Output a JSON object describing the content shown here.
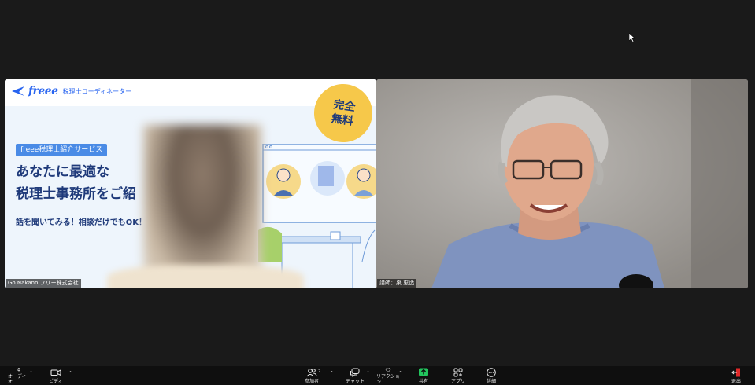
{
  "left_tile": {
    "logo_text": "freee",
    "logo_subtitle": "税理士コーディネーター",
    "badge_line1": "完全",
    "badge_line2": "無料",
    "service_tag": "freee税理士紹介サービス",
    "headline_line1": "あなたに最適な",
    "headline_line2": "税理士事務所をご紹",
    "subline": "話を聞いてみる！相談だけでもOK！",
    "name_label": "Go Nakano フリー株式会社"
  },
  "right_tile": {
    "name_label": "講師：泉 恵造"
  },
  "toolbar": {
    "audio_label": "オーディオ",
    "video_label": "ビデオ",
    "participants_label": "参加者",
    "participants_count": "2",
    "chat_label": "チャット",
    "reactions_label": "リアクション",
    "share_label": "共有",
    "apps_label": "アプリ",
    "more_label": "詳細",
    "leave_label": "退出"
  },
  "colors": {
    "freee_blue": "#2864f0",
    "navy_text": "#1f3a7a",
    "badge_yellow": "#f6c84a",
    "share_green": "#22c55e",
    "leave_red": "#e02828"
  }
}
